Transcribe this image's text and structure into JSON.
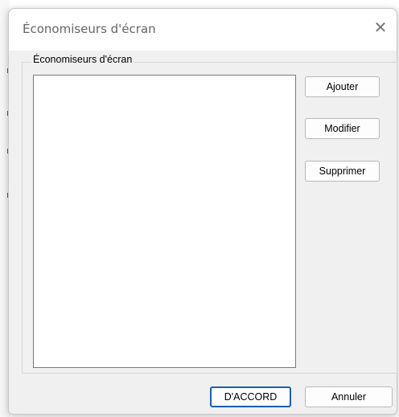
{
  "dialog": {
    "title": "Économiseurs d'écran",
    "close_glyph": "✕",
    "group_label": "Économiseurs d'écran",
    "list_items": [],
    "buttons": {
      "add": "Ajouter",
      "modify": "Modifier",
      "delete": "Supprimer",
      "ok": "D'ACCORD",
      "cancel": "Annuler"
    }
  }
}
